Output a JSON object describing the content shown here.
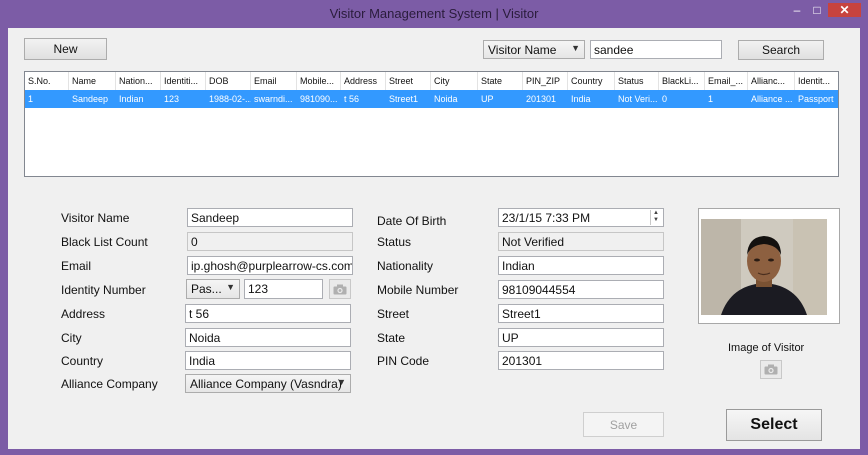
{
  "window": {
    "title": "Visitor Management System | Visitor",
    "minimize": "–",
    "maximize": "□",
    "close": "✕"
  },
  "toolbar": {
    "new_label": "New",
    "search_by_selected": "Visitor Name",
    "search_value": "sandee",
    "search_label": "Search"
  },
  "grid": {
    "columns": [
      "S.No.",
      "Name",
      "Nation...",
      "Identiti...",
      "DOB",
      "Email",
      "Mobile...",
      "Address",
      "Street",
      "City",
      "State",
      "PIN_ZIP",
      "Country",
      "Status",
      "BlackLi...",
      "Email_...",
      "Allianc...",
      "Identit..."
    ],
    "rows": [
      [
        "1",
        "Sandeep",
        "Indian",
        "123",
        "1988-02-...",
        "swarndi...",
        "981090...",
        "t 56",
        "Street1",
        "Noida",
        "UP",
        "201301",
        "India",
        "Not Veri...",
        "0",
        "1",
        "Alliance ...",
        "Passport"
      ]
    ]
  },
  "form": {
    "visitor_name_label": "Visitor Name",
    "visitor_name": "Sandeep",
    "blacklist_label": "Black List Count",
    "blacklist_count": "0",
    "email_label": "Email",
    "email": "ip.ghosh@purplearrow-cs.com",
    "identity_label": "Identity Number",
    "identity_type": "Pas...",
    "identity_number": "123",
    "address_label": "Address",
    "address": "t 56",
    "city_label": "City",
    "city": "Noida",
    "country_label": "Country",
    "country": "India",
    "alliance_label": "Alliance Company",
    "alliance": "Alliance Company (Vasndra)",
    "dob_label": "Date Of Birth",
    "dob": "23/1/15 7:33 PM",
    "status_label": "Status",
    "status": "Not Verified",
    "nationality_label": "Nationality",
    "nationality": "Indian",
    "mobile_label": "Mobile Number",
    "mobile": "98109044554",
    "street_label": "Street",
    "street": "Street1",
    "state_label": "State",
    "state": "UP",
    "pin_label": "PIN Code",
    "pin": "201301"
  },
  "photo": {
    "caption": "Image of Visitor"
  },
  "actions": {
    "save_label": "Save",
    "select_label": "Select"
  },
  "colors": {
    "frame": "#7c5ca6",
    "selected_row": "#3399ff",
    "close_button": "#c7433f"
  }
}
